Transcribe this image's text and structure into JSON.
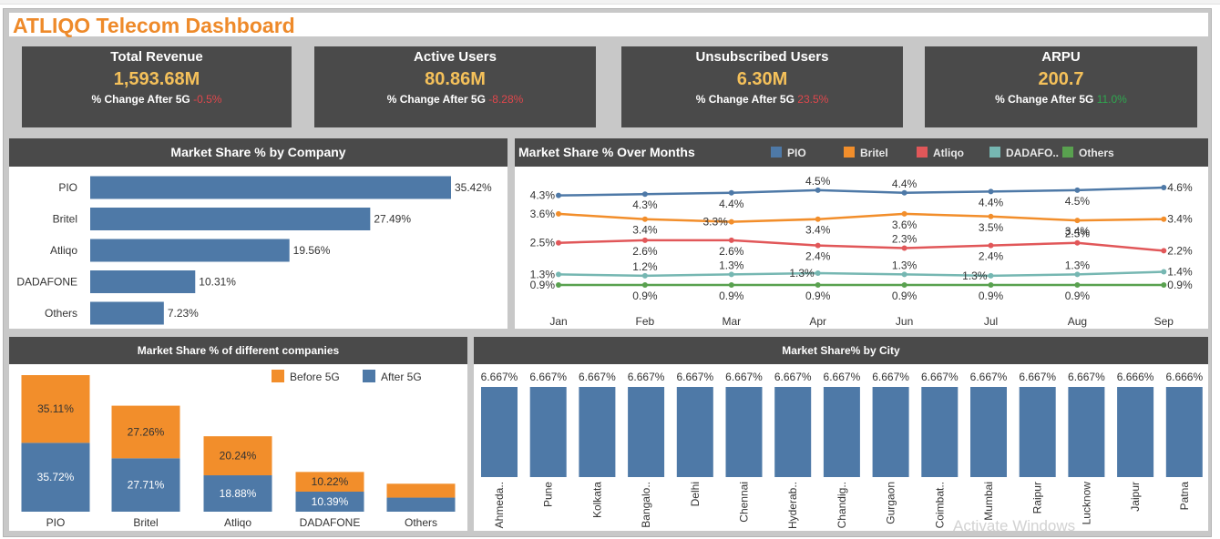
{
  "dashboard": {
    "title": "ATLIQO Telecom Dashboard"
  },
  "kpis": [
    {
      "title": "Total Revenue",
      "value": "1,593.68M",
      "change_label": "% Change After 5G",
      "change_value": "-0.5%",
      "change_color": "#e0474c"
    },
    {
      "title": "Active Users",
      "value": "80.86M",
      "change_label": "% Change After 5G",
      "change_value": "-8.28%",
      "change_color": "#e0474c"
    },
    {
      "title": "Unsubscribed Users",
      "value": "6.30M",
      "change_label": "% Change After 5G",
      "change_value": "23.5%",
      "change_color": "#e0474c"
    },
    {
      "title": "ARPU",
      "value": "200.7",
      "change_label": "% Change After 5G",
      "change_value": "11.0%",
      "change_color": "#2fa84f"
    }
  ],
  "colors": {
    "bar_blue": "#4e79a7",
    "orange": "#f28e2b",
    "red": "#e15759",
    "teal": "#76b7b2",
    "green": "#59a14f",
    "header_bg": "#4a4a4a",
    "title_orange": "#ee8a2a"
  },
  "watermark": "Activate Windows",
  "chart_data": [
    {
      "id": "company_share",
      "type": "bar",
      "orientation": "horizontal",
      "title": "Market Share % by Company",
      "categories": [
        "PIO",
        "Britel",
        "Atliqo",
        "DADAFONE",
        "Others"
      ],
      "values": [
        35.42,
        27.49,
        19.56,
        10.31,
        7.23
      ],
      "labels": [
        "35.42%",
        "27.49%",
        "19.56%",
        "10.31%",
        "7.23%"
      ],
      "xlim": [
        0,
        40
      ]
    },
    {
      "id": "share_over_months",
      "type": "line",
      "title": "Market Share % Over Months",
      "x": [
        "Jan",
        "Feb",
        "Mar",
        "Apr",
        "Jun",
        "Jul",
        "Aug",
        "Sep"
      ],
      "legend": "top",
      "ylim": [
        0.5,
        4.8
      ],
      "series": [
        {
          "name": "PIO",
          "values": [
            4.3,
            4.35,
            4.4,
            4.5,
            4.4,
            4.45,
            4.5,
            4.6
          ],
          "labels": [
            "4.3%",
            "4.3%",
            "4.4%",
            "4.5%",
            "4.4%",
            "4.4%",
            "4.5%",
            "4.6%"
          ]
        },
        {
          "name": "Britel",
          "values": [
            3.6,
            3.4,
            3.3,
            3.4,
            3.6,
            3.5,
            3.35,
            3.4
          ],
          "labels": [
            "3.6%",
            "3.4%",
            "3.3%",
            "3.4%",
            "3.6%",
            "3.5%",
            "3.4%",
            "3.4%"
          ]
        },
        {
          "name": "Atliqo",
          "values": [
            2.5,
            2.6,
            2.6,
            2.4,
            2.3,
            2.4,
            2.5,
            2.2
          ],
          "labels": [
            "2.5%",
            "2.6%",
            "2.6%",
            "2.4%",
            "2.3%",
            "2.4%",
            "2.5%",
            "2.2%"
          ]
        },
        {
          "name": "DADAFO..",
          "values": [
            1.3,
            1.25,
            1.3,
            1.35,
            1.3,
            1.25,
            1.3,
            1.4
          ],
          "labels": [
            "1.3%",
            "1.2%",
            "1.3%",
            "1.3%",
            "1.3%",
            "1.3%",
            "1.3%",
            "1.4%"
          ]
        },
        {
          "name": "Others",
          "values": [
            0.9,
            0.9,
            0.9,
            0.9,
            0.9,
            0.9,
            0.9,
            0.9
          ],
          "labels": [
            "0.9%",
            "0.9%",
            "0.9%",
            "0.9%",
            "0.9%",
            "0.9%",
            "0.9%",
            "0.9%"
          ]
        }
      ]
    },
    {
      "id": "before_after_5g",
      "type": "bar",
      "stacked": true,
      "title": "Market Share % of different companies",
      "categories": [
        "PIO",
        "Britel",
        "Atliqo",
        "DADAFONE",
        "Others"
      ],
      "legend": "top-right",
      "series": [
        {
          "name": "After 5G",
          "values": [
            35.72,
            27.71,
            18.88,
            10.39,
            7.3
          ],
          "labels": [
            "35.72%",
            "27.71%",
            "18.88%",
            "10.39%",
            ""
          ]
        },
        {
          "name": "Before 5G",
          "values": [
            35.11,
            27.26,
            20.24,
            10.22,
            7.2
          ],
          "labels": [
            "35.11%",
            "27.26%",
            "20.24%",
            "10.22%",
            ""
          ]
        }
      ]
    },
    {
      "id": "city_share",
      "type": "bar",
      "title": "Market Share%  by City",
      "categories": [
        "Ahmeda..",
        "Pune",
        "Kolkata",
        "Bangalo..",
        "Delhi",
        "Chennai",
        "Hyderab..",
        "Chandig..",
        "Gurgaon",
        "Coimbat..",
        "Mumbai",
        "Raipur",
        "Lucknow",
        "Jaipur",
        "Patna"
      ],
      "values": [
        6.667,
        6.667,
        6.667,
        6.667,
        6.667,
        6.667,
        6.667,
        6.667,
        6.667,
        6.667,
        6.667,
        6.667,
        6.667,
        6.666,
        6.666
      ],
      "labels": [
        "6.667%",
        "6.667%",
        "6.667%",
        "6.667%",
        "6.667%",
        "6.667%",
        "6.667%",
        "6.667%",
        "6.667%",
        "6.667%",
        "6.667%",
        "6.667%",
        "6.667%",
        "6.666%",
        "6.666%"
      ]
    }
  ]
}
